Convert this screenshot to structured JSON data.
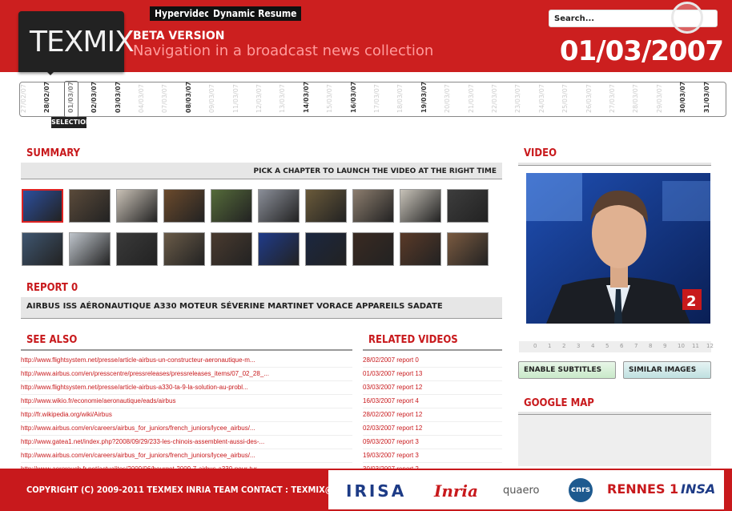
{
  "top_nav": [
    "Hypervideos",
    "Dynamic Resume"
  ],
  "logo": "TEXMIX",
  "beta": "BETA VERSION",
  "subtitle": "Navigation in a broadcast news collection",
  "current_date": "01/03/2007",
  "search": {
    "placeholder": "Search..."
  },
  "timeline": {
    "dates": [
      "27/02/07",
      "28/02/07",
      "01/03/07",
      "02/03/07",
      "03/03/07",
      "04/03/07",
      "07/03/07",
      "08/03/07",
      "09/03/07",
      "11/03/07",
      "12/03/07",
      "13/03/07",
      "14/03/07",
      "15/03/07",
      "16/03/07",
      "17/03/07",
      "18/03/07",
      "19/03/07",
      "20/03/07",
      "21/03/07",
      "22/03/07",
      "23/03/07",
      "24/03/07",
      "25/03/07",
      "26/03/07",
      "27/03/07",
      "28/03/07",
      "29/03/07",
      "30/03/07",
      "31/03/07"
    ],
    "selection_label": "SELECTION"
  },
  "summary": {
    "heading": "SUMMARY",
    "hint": "PICK A CHAPTER TO LAUNCH THE VIDEO AT THE RIGHT TIME"
  },
  "report": {
    "heading": "REPORT 0",
    "keywords": "AIRBUS ISS AÉRONAUTIQUE A330 MOTEUR SÉVERINE MARTINET VORACE APPAREILS SADATE"
  },
  "see_also": {
    "heading": "SEE ALSO",
    "links": [
      "http://www.flightsystem.net/presse/article-airbus-un-constructeur-aeronautique-m...",
      "http://www.airbus.com/en/presscentre/pressreleases/pressreleases_items/07_02_28_...",
      "http://www.flightsystem.net/presse/article-airbus-a330-ta-9-la-solution-au-probl...",
      "http://www.wikio.fr/economie/aeronautique/eads/airbus",
      "http://fr.wikipedia.org/wiki/Airbus",
      "http://www.airbus.com/en/careers/airbus_for_juniors/french_juniors/lycee_airbus/...",
      "http://www.gatea1.net/index.php?2008/09/29/233-les-chinois-assemblent-aussi-des-...",
      "http://www.airbus.com/en/careers/airbus_for_juniors/french_juniors/lycee_airbus/...",
      "http://www.aerorouch.fr.net/actualites/2009/06/bourget-2009-7-airbus-a330-pour-tur..."
    ]
  },
  "related": {
    "heading": "RELATED VIDEOS",
    "items": [
      "28/02/2007 report 0",
      "01/03/2007 report 13",
      "03/03/2007 report 12",
      "16/03/2007 report 4",
      "28/02/2007 report 12",
      "02/03/2007 report 12",
      "09/03/2007 report 3",
      "19/03/2007 report 3",
      "30/03/2007 report 2"
    ]
  },
  "video": {
    "heading": "VIDEO",
    "pages": [
      "0",
      "1",
      "2",
      "3",
      "4",
      "5",
      "6",
      "7",
      "8",
      "9",
      "10",
      "11",
      "12"
    ],
    "subtitles_button": "ENABLE SUBTITLES",
    "similar_button": "SIMILAR IMAGES"
  },
  "map": {
    "heading": "GOOGLE MAP"
  },
  "footer": {
    "copyright": "COPYRIGHT (C) 2009-2011 TEXMEX INRIA TEAM CONTACT : TEXMIX@IRISA.FR",
    "sponsors": [
      "IRISA",
      "Inria",
      "quaero",
      "cnrs",
      "RENNES 1",
      "INSA"
    ]
  },
  "colors": {
    "brand_red": "#c8191c",
    "dark": "#222222"
  }
}
